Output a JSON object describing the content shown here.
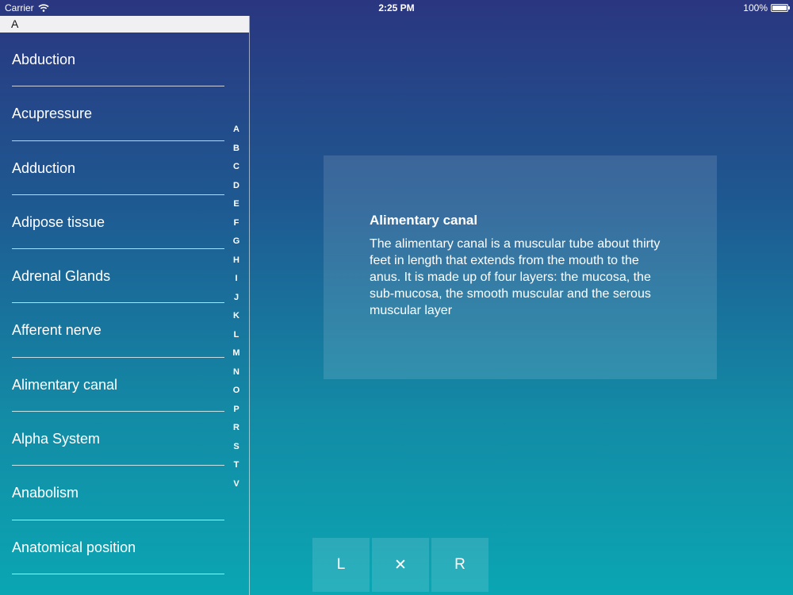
{
  "status_bar": {
    "carrier": "Carrier",
    "time": "2:25 PM",
    "battery": "100%",
    "battery_level": 1.0
  },
  "list": {
    "section_header": "A",
    "items": [
      {
        "label": "Abduction"
      },
      {
        "label": "Acupressure"
      },
      {
        "label": "Adduction"
      },
      {
        "label": "Adipose tissue"
      },
      {
        "label": "Adrenal Glands"
      },
      {
        "label": "Afferent nerve"
      },
      {
        "label": "Alimentary canal"
      },
      {
        "label": "Alpha System"
      },
      {
        "label": "Anabolism"
      },
      {
        "label": "Anatomical position"
      }
    ],
    "index": [
      "A",
      "B",
      "C",
      "D",
      "E",
      "F",
      "G",
      "H",
      "I",
      "J",
      "K",
      "L",
      "M",
      "N",
      "O",
      "P",
      "R",
      "S",
      "T",
      "V"
    ]
  },
  "definition": {
    "title": "Alimentary canal",
    "text": "The alimentary canal is a muscular tube about thirty feet in length that extends from the mouth to the anus. It is made up of four layers: the mucosa, the sub-mucosa, the smooth muscular and the serous muscular layer"
  },
  "controls": {
    "left_label": "L",
    "close_label": "✕",
    "right_label": "R"
  }
}
